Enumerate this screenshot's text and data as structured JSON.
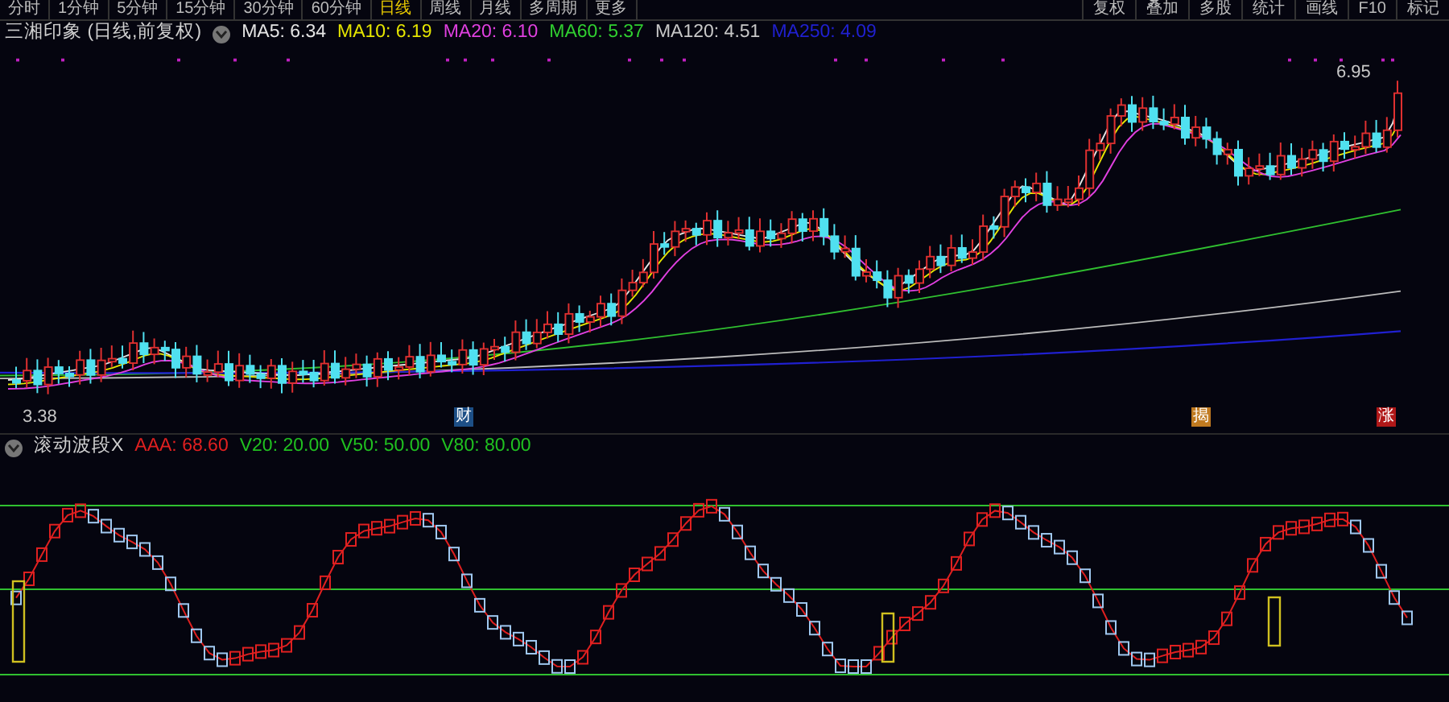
{
  "toolbar": {
    "left": [
      {
        "label": "分时",
        "selected": false
      },
      {
        "label": "1分钟",
        "selected": false
      },
      {
        "label": "5分钟",
        "selected": false
      },
      {
        "label": "15分钟",
        "selected": false
      },
      {
        "label": "30分钟",
        "selected": false
      },
      {
        "label": "60分钟",
        "selected": false
      },
      {
        "label": "日线",
        "selected": true
      },
      {
        "label": "周线",
        "selected": false
      },
      {
        "label": "月线",
        "selected": false
      },
      {
        "label": "多周期",
        "selected": false
      },
      {
        "label": "更多",
        "selected": false
      }
    ],
    "right": [
      "复权",
      "叠加",
      "多股",
      "统计",
      "画线",
      "F10",
      "标记"
    ]
  },
  "main_legend": {
    "title": "三湘印象 (日线,前复权)",
    "indicators": [
      {
        "label": "MA5: 6.34",
        "color": "#e6e6e6"
      },
      {
        "label": "MA10: 6.19",
        "color": "#e6e600"
      },
      {
        "label": "MA20: 6.10",
        "color": "#e040e0"
      },
      {
        "label": "MA60: 5.37",
        "color": "#30d030"
      },
      {
        "label": "MA120: 4.51",
        "color": "#c8c8c8"
      },
      {
        "label": "MA250: 4.09",
        "color": "#2020d0"
      }
    ]
  },
  "main_chart": {
    "high_label": "6.95",
    "low_label": "3.38",
    "event_markers": [
      {
        "label": "财",
        "color": "#1d4f86"
      },
      {
        "label": "揭",
        "color": "#c07a20"
      },
      {
        "label": "涨",
        "color": "#b01818"
      }
    ]
  },
  "sub_legend": {
    "title": "滚动波段X",
    "indicators": [
      {
        "label": "AAA: 68.60",
        "color": "#e02020"
      },
      {
        "label": "V20: 20.00",
        "color": "#20c020"
      },
      {
        "label": "V50: 50.00",
        "color": "#20c020"
      },
      {
        "label": "V80: 80.00",
        "color": "#20c020"
      }
    ]
  }
}
